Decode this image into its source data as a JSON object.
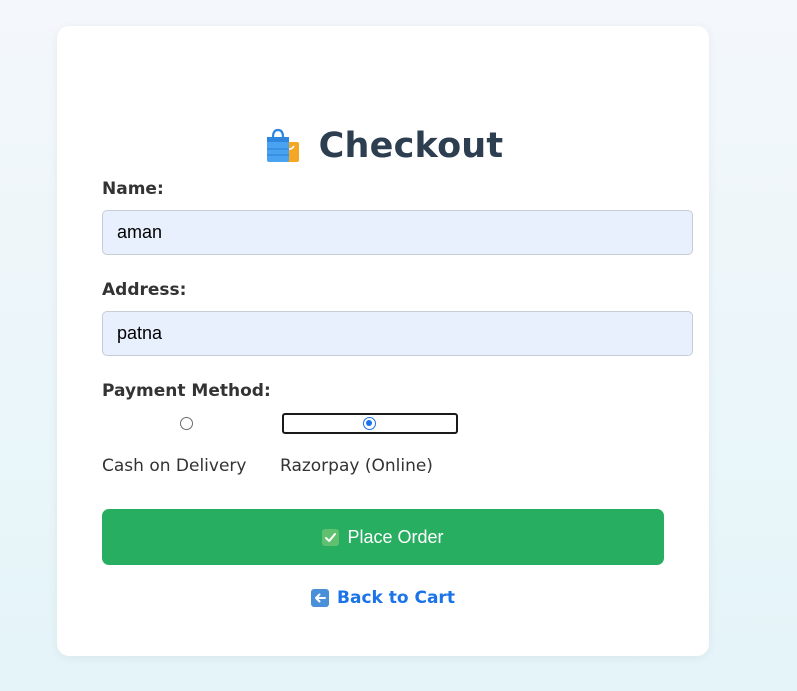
{
  "checkout": {
    "title": "Checkout",
    "title_icon": "shopping-bags-icon",
    "name_label": "Name:",
    "name_value": "aman",
    "address_label": "Address:",
    "address_value": "patna",
    "payment_label": "Payment Method:",
    "payment_options": [
      {
        "label": "Cash on Delivery",
        "selected": false
      },
      {
        "label": "Razorpay (Online)",
        "selected": true
      }
    ],
    "place_order_label": "Place Order",
    "place_order_icon": "check-mark-button-icon",
    "back_label": "Back to Cart",
    "back_icon": "left-arrow-icon"
  },
  "colors": {
    "title": "#2c3e50",
    "input_bg": "#e8f0fe",
    "button_bg": "#27ae60",
    "link": "#1a73e8"
  }
}
